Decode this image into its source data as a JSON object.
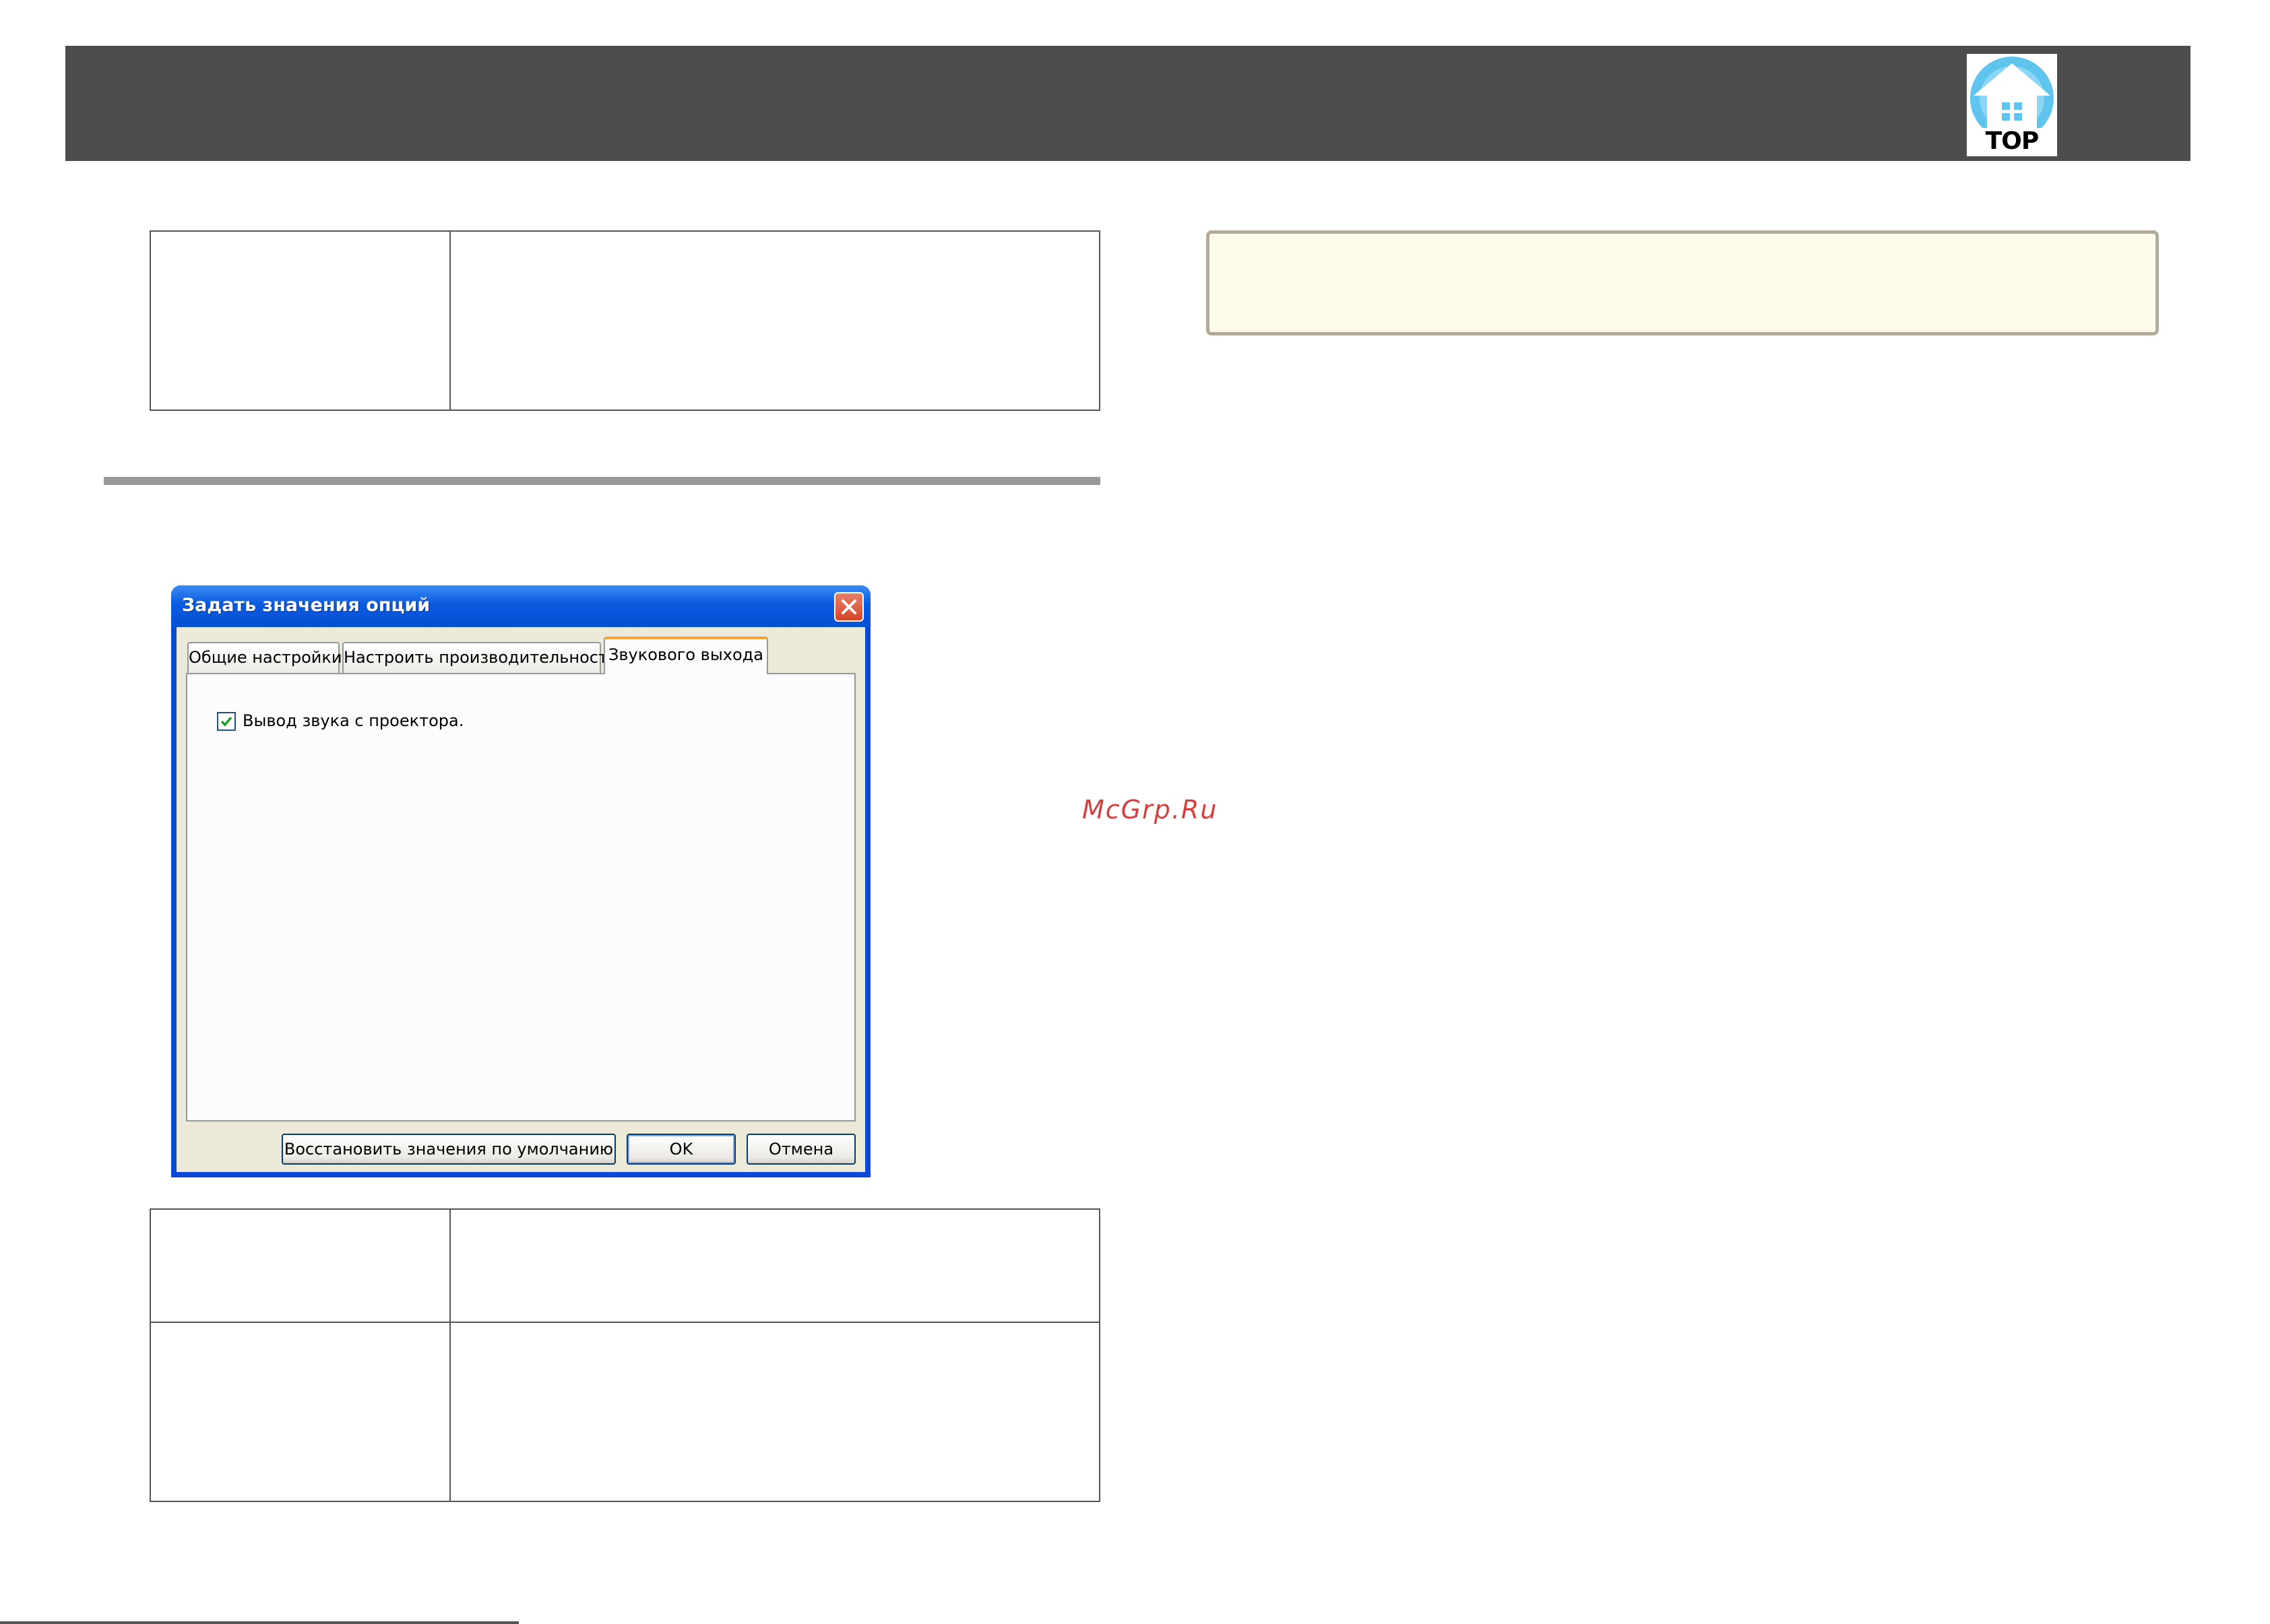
{
  "header": {
    "logo_text": "TOP",
    "logo_icon": "house-icon"
  },
  "dialog": {
    "title": "Задать значения опций",
    "close_icon": "close-icon",
    "tabs": [
      {
        "label": "Общие настройки",
        "active": false
      },
      {
        "label": "Настроить производительность",
        "active": false
      },
      {
        "label": "Звукового выхода",
        "active": true
      }
    ],
    "checkbox": {
      "label": "Вывод звука с проектора.",
      "checked": true
    },
    "buttons": {
      "restore_defaults": "Восстановить значения по умолчанию",
      "ok": "OK",
      "cancel": "Отмена"
    }
  },
  "watermark": "McGrp.Ru",
  "colors": {
    "header_bar": "#4d4d4d",
    "note_background": "#fffbea",
    "note_border": "#b3ab98",
    "section_rule": "#999999",
    "dialog_frame": "#0a48d8",
    "watermark": "#d44040"
  }
}
